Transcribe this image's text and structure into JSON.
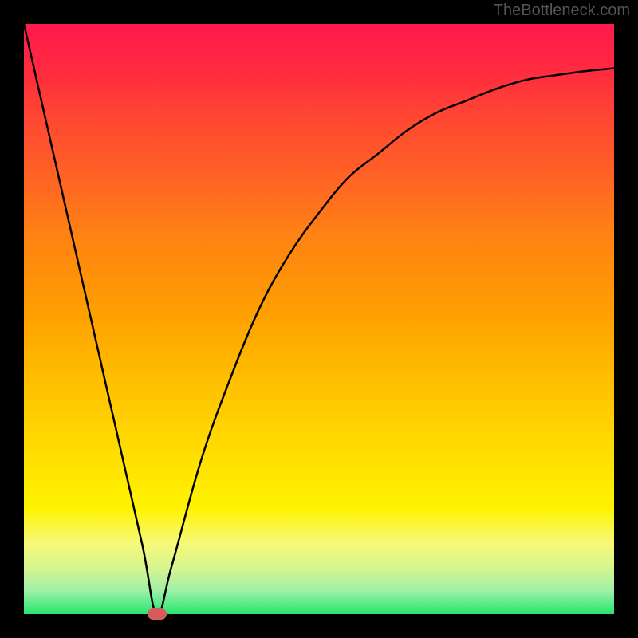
{
  "attribution": "TheBottleneck.com",
  "chart_data": {
    "type": "line",
    "title": "",
    "xlabel": "",
    "ylabel": "",
    "xlim": [
      0,
      100
    ],
    "ylim": [
      0,
      100
    ],
    "series": [
      {
        "name": "bottleneck-curve",
        "x": [
          0,
          5,
          10,
          15,
          20,
          22.5,
          25,
          30,
          35,
          40,
          45,
          50,
          55,
          60,
          65,
          70,
          75,
          80,
          85,
          90,
          95,
          100
        ],
        "values": [
          100,
          78,
          56,
          34,
          12,
          0,
          8,
          26,
          40,
          52,
          61,
          68,
          74,
          78,
          82,
          85,
          87,
          89,
          90.5,
          91.3,
          92,
          92.5
        ]
      }
    ],
    "annotations": [
      {
        "name": "optimal-marker",
        "x": 22.5,
        "y": 0,
        "color": "#d45c5c"
      }
    ],
    "background_gradient": {
      "top": "#ff1a4d",
      "middle": "#ffc300",
      "bottom": "#27e56e"
    }
  }
}
